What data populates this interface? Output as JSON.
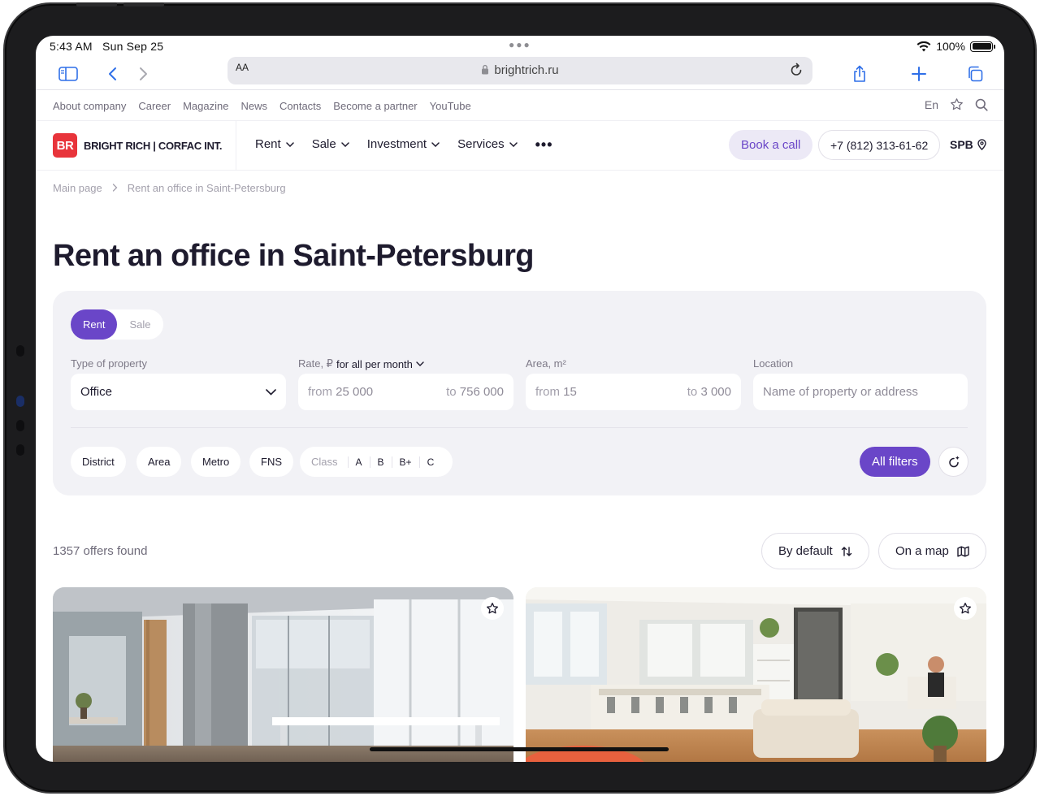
{
  "status": {
    "time": "5:43 AM",
    "date": "Sun Sep 25",
    "battery": "100%"
  },
  "browser": {
    "aa": "AA",
    "url": "brightrich.ru"
  },
  "toplinks": {
    "items": [
      "About company",
      "Career",
      "Magazine",
      "News",
      "Contacts",
      "Become a partner",
      "YouTube"
    ],
    "lang": "En"
  },
  "nav": {
    "logo_mark": "BR",
    "logo_text": "BRIGHT RICH | CORFAC INT.",
    "items": [
      "Rent",
      "Sale",
      "Investment",
      "Services"
    ],
    "book_call": "Book a call",
    "phone": "+7 (812) 313-61-62",
    "city": "SPB"
  },
  "breadcrumb": {
    "home": "Main page",
    "current": "Rent an office in Saint-Petersburg"
  },
  "page_title": "Rent an office in Saint-Petersburg",
  "filters": {
    "deal_toggle": {
      "active": "Rent",
      "inactive": "Sale"
    },
    "type": {
      "label": "Type of property",
      "value": "Office"
    },
    "rate": {
      "label": "Rate, ₽",
      "period": "for all per month",
      "from_label": "from",
      "from": "25 000",
      "to_label": "to",
      "to": "756 000"
    },
    "area": {
      "label": "Area, m²",
      "from_label": "from",
      "from": "15",
      "to_label": "to",
      "to": "3 000"
    },
    "location": {
      "label": "Location",
      "placeholder": "Name of property or address"
    },
    "chips": [
      "District",
      "Area",
      "Metro",
      "FNS"
    ],
    "class": {
      "label": "Class",
      "options": [
        "A",
        "B",
        "B+",
        "C"
      ]
    },
    "all_filters": "All filters"
  },
  "results": {
    "count": "1357 offers found",
    "sort": "By default",
    "map": "On a map"
  },
  "colors": {
    "accent": "#6a46c8",
    "brand": "#e8343b",
    "panel": "#f2f2f6"
  }
}
